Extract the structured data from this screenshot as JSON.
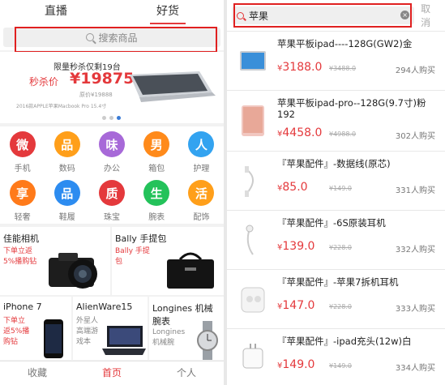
{
  "left": {
    "tabs": [
      {
        "label": "直播"
      },
      {
        "label": "好货"
      }
    ],
    "search": {
      "placeholder": "搜索商品"
    },
    "banner": {
      "subtitle": "限量秒杀仅剩19台",
      "price_label": "秒杀价",
      "price": "¥19875",
      "original": "原价¥19888",
      "caption": "2016款APPLE苹果Macbook Pro 15.4寸"
    },
    "categories": [
      {
        "char": "微",
        "label": "手机",
        "color": "#e4393c"
      },
      {
        "char": "品",
        "label": "数码",
        "color": "#ff9f1a"
      },
      {
        "char": "味",
        "label": "办公",
        "color": "#a769d8"
      },
      {
        "char": "男",
        "label": "箱包",
        "color": "#ff8a1a"
      },
      {
        "char": "人",
        "label": "护理",
        "color": "#33a3f0"
      },
      {
        "char": "享",
        "label": "轻奢",
        "color": "#ff7a1a"
      },
      {
        "char": "品",
        "label": "鞋履",
        "color": "#2d8cf0"
      },
      {
        "char": "质",
        "label": "珠宝",
        "color": "#e4393c"
      },
      {
        "char": "生",
        "label": "腕表",
        "color": "#23c25a"
      },
      {
        "char": "活",
        "label": "配饰",
        "color": "#ff9f1a"
      }
    ],
    "cards_row1": [
      {
        "title": "佳能相机",
        "line1": "下单立返",
        "line2": "5%播购钻"
      },
      {
        "title": "Bally 手提包",
        "line1": "Bally 手提",
        "line2": "包"
      }
    ],
    "cards_row2": [
      {
        "title": "iPhone 7",
        "line1": "下单立",
        "line2": "返5%播",
        "line3": "购钻"
      },
      {
        "title": "AlienWare15",
        "line1": "外星人",
        "line2": "高端游",
        "line3": "戏本"
      },
      {
        "title": "Longines 机械",
        "title2": "腕表",
        "line1": "Longines",
        "line2": "机械腕"
      }
    ],
    "bottom_nav": [
      {
        "label": "收藏"
      },
      {
        "label": "首页"
      },
      {
        "label": "个人"
      }
    ]
  },
  "right": {
    "search": {
      "value": "苹果",
      "cancel": "取消"
    },
    "items": [
      {
        "name": "苹果平板ipad----128G(GW2)金",
        "price": "3188.0",
        "orig": "¥3488.0",
        "buys": "294人购买"
      },
      {
        "name": "苹果平板ipad-pro--128G(9.7寸)粉192",
        "price": "4458.0",
        "orig": "¥4988.0",
        "buys": "302人购买"
      },
      {
        "name": "『苹果配件』-数据线(原芯)",
        "price": "85.0",
        "orig": "¥149.0",
        "buys": "331人购买"
      },
      {
        "name": "『苹果配件』-6S原装耳机",
        "price": "139.0",
        "orig": "¥228.0",
        "buys": "332人购买"
      },
      {
        "name": "『苹果配件』-苹果7拆机耳机",
        "price": "147.0",
        "orig": "¥228.0",
        "buys": "333人购买"
      },
      {
        "name": "『苹果配件』-ipad充头(12w)白",
        "price": "149.0",
        "orig": "¥149.0",
        "buys": "334人购买"
      }
    ],
    "currency": "¥"
  },
  "accent_color": "#e4393c"
}
